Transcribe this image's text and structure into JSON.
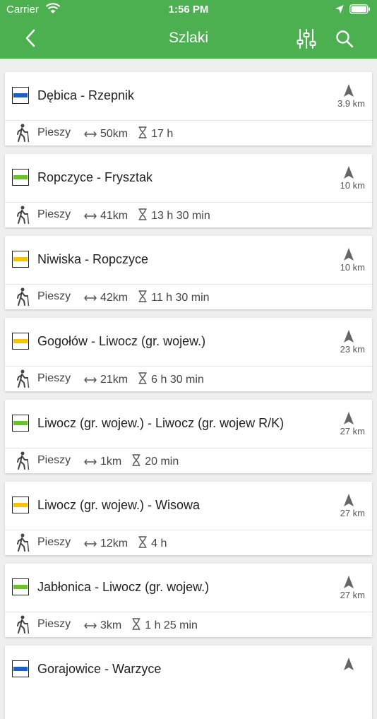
{
  "status": {
    "carrier": "Carrier",
    "time": "1:56 PM"
  },
  "header": {
    "title": "Szlaki"
  },
  "colors": {
    "brand": "#4caf50",
    "blue": "#1e5fc4",
    "green": "#6cc12a",
    "yellow": "#f5c400"
  },
  "trails": [
    {
      "name": "Dębica - Rzepnik",
      "color": "#1e5fc4",
      "distance": "3.9 km",
      "type": "Pieszy",
      "length": "50km",
      "time": "17 h"
    },
    {
      "name": "Ropczyce - Frysztak",
      "color": "#6cc12a",
      "distance": "10 km",
      "type": "Pieszy",
      "length": "41km",
      "time": "13 h 30 min"
    },
    {
      "name": "Niwiska - Ropczyce",
      "color": "#f5c400",
      "distance": "10 km",
      "type": "Pieszy",
      "length": "42km",
      "time": "11 h 30 min"
    },
    {
      "name": "Gogołów - Liwocz (gr. wojew.)",
      "color": "#f5c400",
      "distance": "23 km",
      "type": "Pieszy",
      "length": "21km",
      "time": "6 h 30 min"
    },
    {
      "name": "Liwocz (gr. wojew.) - Liwocz (gr. wojew R/K)",
      "color": "#6cc12a",
      "distance": "27 km",
      "type": "Pieszy",
      "length": "1km",
      "time": "20 min"
    },
    {
      "name": "Liwocz (gr. wojew.) - Wisowa",
      "color": "#f5c400",
      "distance": "27 km",
      "type": "Pieszy",
      "length": "12km",
      "time": "4 h"
    },
    {
      "name": "Jabłonica - Liwocz (gr. wojew.)",
      "color": "#6cc12a",
      "distance": "27 km",
      "type": "Pieszy",
      "length": "3km",
      "time": "1 h 25 min"
    },
    {
      "name": "Gorajowice - Warzyce",
      "color": "#1e5fc4",
      "distance": "",
      "type": "",
      "length": "",
      "time": ""
    }
  ]
}
